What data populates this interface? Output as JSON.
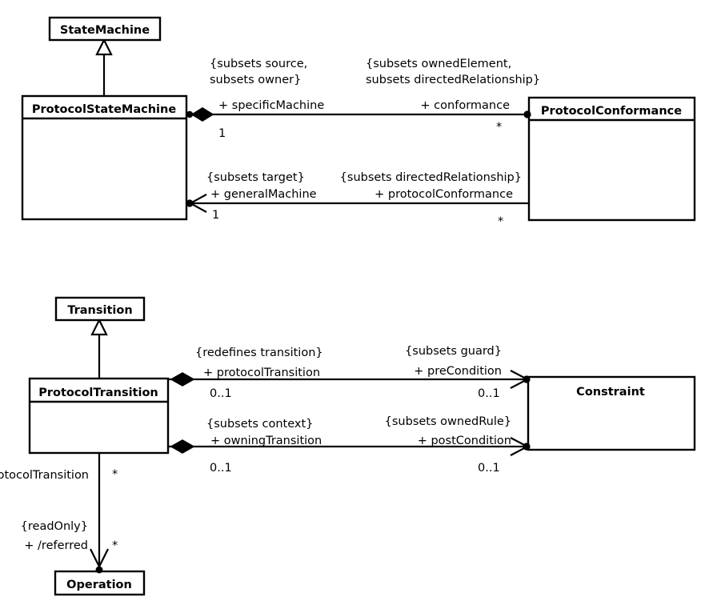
{
  "diagram": {
    "title": "UML ProtocolStateMachine and ProtocolTransition metamodel diagram",
    "background_color": "#ffffff",
    "line_color": "#000000",
    "text_color": "#000000"
  },
  "classes": {
    "state_machine": "StateMachine",
    "protocol_state_machine": "ProtocolStateMachine",
    "protocol_conformance": "ProtocolConformance",
    "transition": "Transition",
    "protocol_transition": "ProtocolTransition",
    "constraint": "Constraint",
    "operation": "Operation"
  },
  "associations": {
    "conformance": {
      "left_constraint_line1": "{subsets source,",
      "left_constraint_line2": "subsets owner}",
      "left_role": "+ specificMachine",
      "left_multiplicity": "1",
      "right_constraint_line1": "{subsets ownedElement,",
      "right_constraint_line2": "subsets directedRelationship}",
      "right_role": "+ conformance",
      "right_multiplicity": "*"
    },
    "general_machine": {
      "left_constraint": "{subsets target}",
      "left_role": "+ generalMachine",
      "left_multiplicity": "1",
      "right_constraint": "{subsets directedRelationship}",
      "right_role": "+ protocolConformance",
      "right_multiplicity": "*"
    },
    "pre_condition": {
      "left_constraint": "{redefines transition}",
      "left_role": "+ protocolTransition",
      "left_multiplicity": "0..1",
      "right_constraint": "{subsets guard}",
      "right_role": "+ preCondition",
      "right_multiplicity": "0..1"
    },
    "post_condition": {
      "left_constraint": "{subsets context}",
      "left_role": "+ owningTransition",
      "left_multiplicity": "0..1",
      "right_constraint": "{subsets ownedRule}",
      "right_role": "+ postCondition",
      "right_multiplicity": "0..1"
    },
    "referred": {
      "top_role_clipped": "otocolTransition",
      "top_multiplicity": "*",
      "bottom_constraint": "{readOnly}",
      "bottom_role": "+ /referred",
      "bottom_multiplicity": "*"
    }
  }
}
